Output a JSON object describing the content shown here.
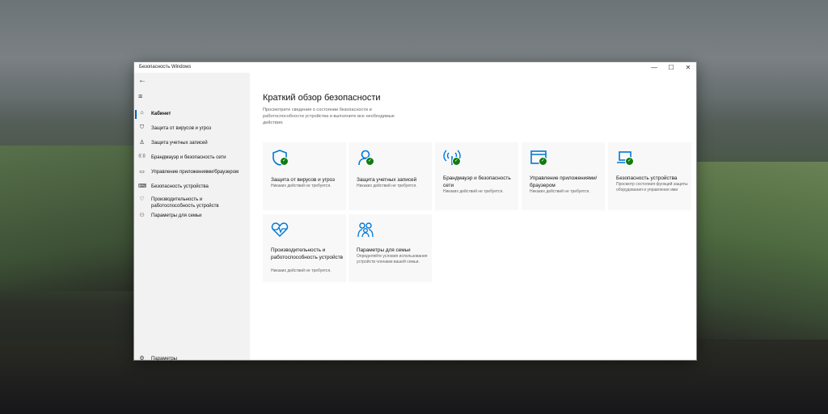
{
  "window": {
    "title": "Безопасность Windows",
    "min_glyph": "—",
    "max_glyph": "☐",
    "close_glyph": "✕"
  },
  "sidebar": {
    "back_glyph": "←",
    "menu_glyph": "≡",
    "items": [
      {
        "label": "Кабинет",
        "icon": "home-icon",
        "glyph": "⌂"
      },
      {
        "label": "Защита от вирусов и угроз",
        "icon": "shield-icon",
        "glyph": "⛉"
      },
      {
        "label": "Защита учетных записей",
        "icon": "person-icon",
        "glyph": "♙"
      },
      {
        "label": "Брандмауэр и безопасность сети",
        "icon": "antenna-icon",
        "glyph": "((·))"
      },
      {
        "label": "Управление приложениями/браузером",
        "icon": "browser-icon",
        "glyph": "▭"
      },
      {
        "label": "Безопасность устройства",
        "icon": "laptop-icon",
        "glyph": "⌨"
      },
      {
        "label": "Производительность и работоспособность устройств",
        "icon": "heart-icon",
        "glyph": "♡"
      },
      {
        "label": "Параметры для семьи",
        "icon": "family-icon",
        "glyph": "⚇"
      }
    ],
    "settings_label": "Параметры",
    "settings_glyph": "⚙"
  },
  "main": {
    "heading": "Краткий обзор безопасности",
    "intro": "Просмотрите сведения о состоянии безопасности и работоспособности устройства и выполните все необходимые действия.",
    "tiles": [
      {
        "name": "Защита от вирусов и угроз",
        "desc": "Никаких действий не требуется.",
        "icon": "shield-icon",
        "check": "✓"
      },
      {
        "name": "Защита учетных записей",
        "desc": "Никаких действий не требуется.",
        "icon": "person-icon",
        "check": "✓"
      },
      {
        "name": "Брандмауэр и безопасность сети",
        "desc": "Никаких действий не требуется.",
        "icon": "antenna-icon",
        "check": "✓"
      },
      {
        "name": "Управление приложениями/браузером",
        "desc": "Никаких действий не требуется.",
        "icon": "browser-icon",
        "check": "✓"
      },
      {
        "name": "Безопасность устройства",
        "desc": "Просмотр состояния функций защиты оборудования и управление ими",
        "icon": "laptop-icon",
        "check": "✓"
      },
      {
        "name": "Производительность и работоспособность устройств",
        "desc": "Никаких действий не требуется.",
        "icon": "heart-icon"
      },
      {
        "name": "Параметры для семьи",
        "desc": "Определяйте условия использования устройств членами вашей семьи.",
        "icon": "family-icon"
      }
    ]
  },
  "colors": {
    "accent": "#0063b1",
    "ok": "#107c10",
    "icon_blue": "#0078d7"
  }
}
